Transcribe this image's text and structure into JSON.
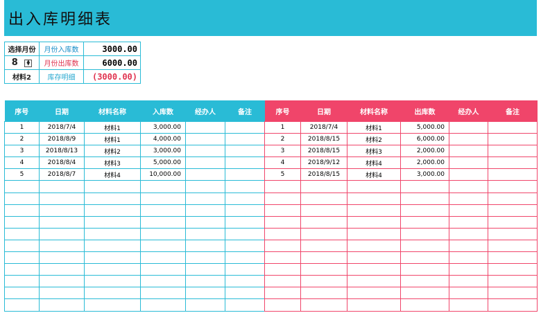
{
  "title": "出入库明细表",
  "summary": {
    "month_label": "选择月份",
    "month_value": "8",
    "material_label": "材料2",
    "in_label": "月份入库数",
    "in_value": "3000.00",
    "out_label": "月份出库数",
    "out_value": "6000.00",
    "stock_label": "库存明细",
    "stock_value": "(3000.00)"
  },
  "in_table": {
    "headers": [
      "序号",
      "日期",
      "材料名称",
      "入库数",
      "经办人",
      "备注"
    ],
    "rows": [
      [
        "1",
        "2018/7/4",
        "材料1",
        "3,000.00",
        "",
        ""
      ],
      [
        "2",
        "2018/8/9",
        "材料1",
        "4,000.00",
        "",
        ""
      ],
      [
        "3",
        "2018/8/13",
        "材料2",
        "3,000.00",
        "",
        ""
      ],
      [
        "4",
        "2018/8/4",
        "材料3",
        "5,000.00",
        "",
        ""
      ],
      [
        "5",
        "2018/8/7",
        "材料4",
        "10,000.00",
        "",
        ""
      ]
    ]
  },
  "out_table": {
    "headers": [
      "序号",
      "日期",
      "材料名称",
      "出库数",
      "经办人",
      "备注"
    ],
    "rows": [
      [
        "1",
        "2018/7/4",
        "材料1",
        "5,000.00",
        "",
        ""
      ],
      [
        "2",
        "2018/8/15",
        "材料2",
        "6,000.00",
        "",
        ""
      ],
      [
        "3",
        "2018/8/15",
        "材料3",
        "2,000.00",
        "",
        ""
      ],
      [
        "4",
        "2018/9/12",
        "材料4",
        "2,000.00",
        "",
        ""
      ],
      [
        "5",
        "2018/8/15",
        "材料4",
        "3,000.00",
        "",
        ""
      ]
    ]
  },
  "colors": {
    "in_accent": "#29BBD6",
    "out_accent": "#F0456A"
  }
}
